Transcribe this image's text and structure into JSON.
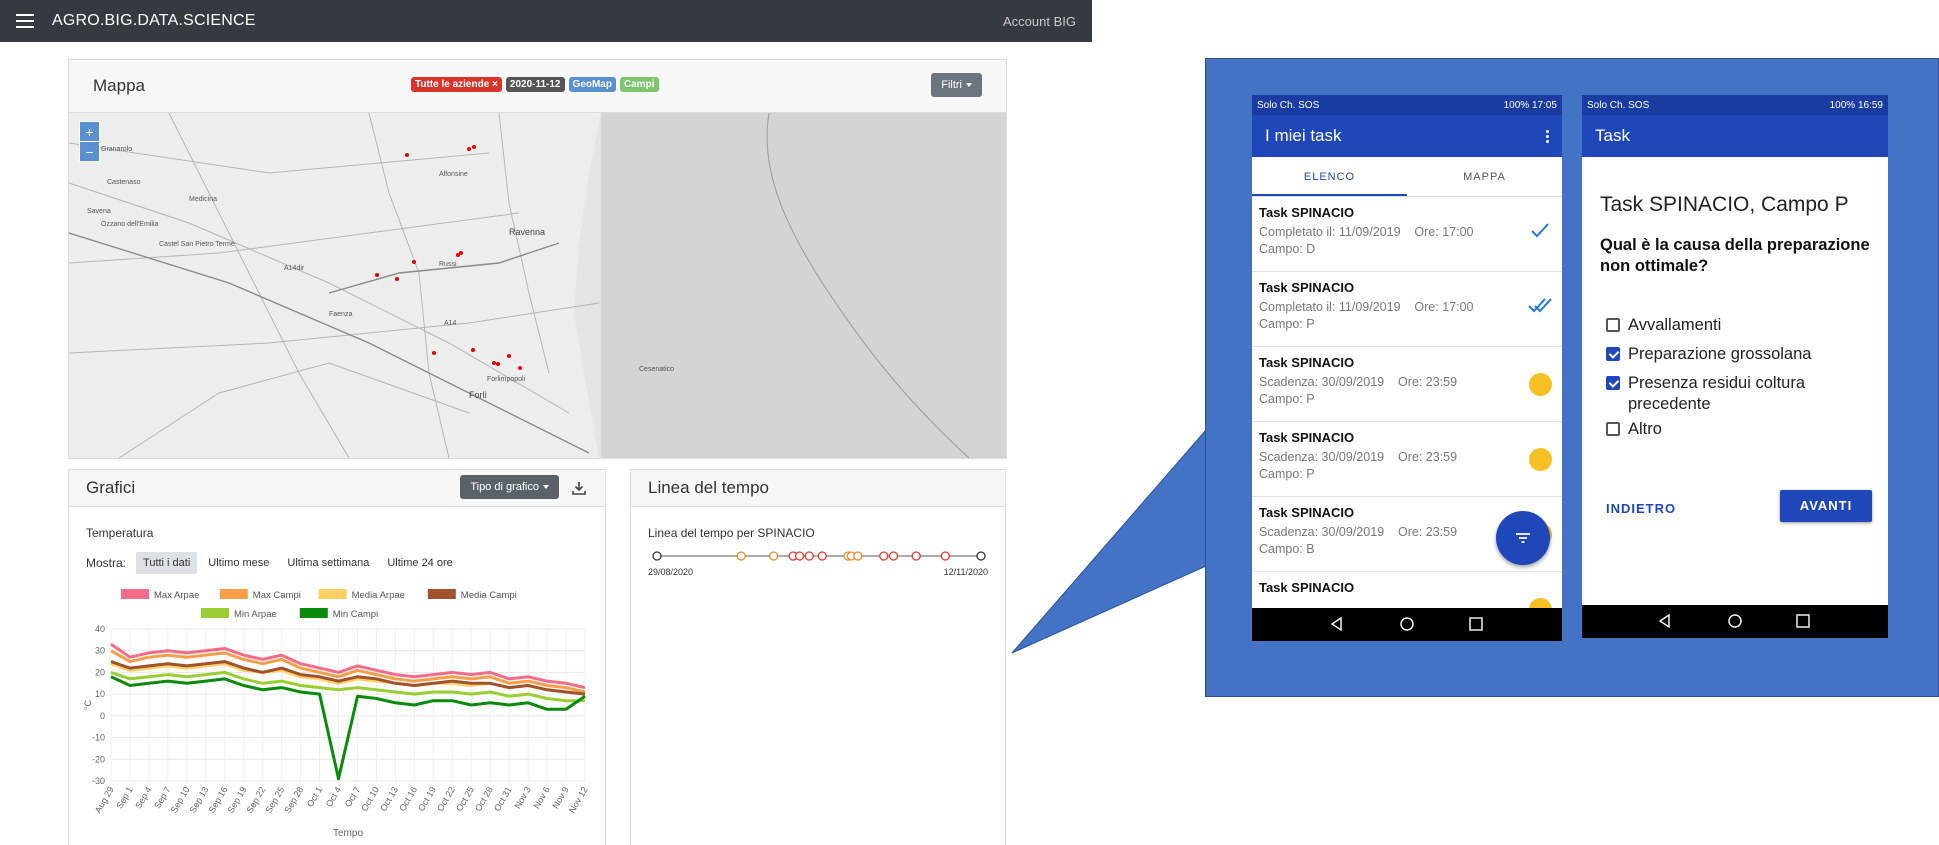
{
  "navbar": {
    "brand": "AGRO.BIG.DATA.SCIENCE",
    "account": "Account BIG"
  },
  "map_card": {
    "title": "Mappa",
    "badges": [
      {
        "label": "Tutte le aziende ×",
        "color": "#d9342b"
      },
      {
        "label": "2020-11-12",
        "color": "#555555"
      },
      {
        "label": "GeoMap",
        "color": "#5a8fd0"
      },
      {
        "label": "Campi",
        "color": "#7cc66b"
      }
    ],
    "filtri_label": "Filtri",
    "zoom_in": "+",
    "zoom_out": "−",
    "place_labels": [
      "Granarolo",
      "Castenaso",
      "Medicina",
      "Savena",
      "Ozzano dell'Emilia",
      "Castel San Pietro Terme",
      "Alfonsine",
      "Ravenna",
      "Russi",
      "A14dir",
      "Faenza",
      "A14",
      "Forlì",
      "Cesenatico",
      "Forlimpopoli"
    ],
    "dot_color": "#e00000"
  },
  "grafici_card": {
    "title": "Grafici",
    "tipo_label": "Tipo di grafico",
    "mostra_label": "Mostra:",
    "range_options": [
      "Tutti i dati",
      "Ultimo mese",
      "Ultima settimana",
      "Ultime 24 ore"
    ],
    "selected_range": "Tutti i dati"
  },
  "linea_card": {
    "title": "Linea del tempo",
    "subtitle": "Linea del tempo per SPINACIO",
    "start_date": "29/08/2020",
    "end_date": "12/11/2020"
  },
  "chart_data": {
    "type": "line",
    "title": "Temperatura",
    "xlabel": "Tempo",
    "ylabel": "°C",
    "ylim": [
      -30,
      40
    ],
    "yticks": [
      40,
      30,
      20,
      10,
      0,
      -10,
      -20,
      -30
    ],
    "categories": [
      "Aug 29",
      "Sep 1",
      "Sep 4",
      "Sep 7",
      "Sep 10",
      "Sep 13",
      "Sep 16",
      "Sep 19",
      "Sep 22",
      "Sep 25",
      "Sep 28",
      "Oct 1",
      "Oct 4",
      "Oct 7",
      "Oct 10",
      "Oct 13",
      "Oct 16",
      "Oct 19",
      "Oct 22",
      "Oct 25",
      "Oct 28",
      "Oct 31",
      "Nov 3",
      "Nov 6",
      "Nov 9",
      "Nov 12"
    ],
    "series": [
      {
        "name": "Max Arpae",
        "color": "#f66a8a",
        "values": [
          33,
          27,
          29,
          30,
          29,
          30,
          31,
          28,
          26,
          28,
          24,
          22,
          20,
          23,
          21,
          19,
          18,
          19,
          20,
          19,
          20,
          17,
          18,
          16,
          15,
          13
        ]
      },
      {
        "name": "Max Campi",
        "color": "#fb9e4a",
        "values": [
          30,
          25,
          27,
          28,
          27,
          28,
          29,
          26,
          24,
          26,
          22,
          20,
          18,
          21,
          19,
          17,
          16,
          17,
          18,
          17,
          18,
          15,
          16,
          14,
          13,
          11
        ]
      },
      {
        "name": "Media Arpae",
        "color": "#fcd064",
        "values": [
          24,
          21,
          22,
          23,
          22,
          23,
          24,
          21,
          20,
          21,
          18,
          17,
          15,
          17,
          16,
          15,
          14,
          15,
          15,
          14,
          15,
          13,
          14,
          12,
          11,
          10
        ]
      },
      {
        "name": "Media Campi",
        "color": "#a0522d",
        "values": [
          25,
          22,
          23,
          24,
          23,
          24,
          25,
          22,
          20,
          22,
          19,
          18,
          16,
          18,
          17,
          15,
          14,
          15,
          16,
          15,
          15,
          13,
          14,
          12,
          11,
          10
        ]
      },
      {
        "name": "Min Arpae",
        "color": "#9acd32",
        "values": [
          20,
          17,
          18,
          19,
          18,
          19,
          20,
          17,
          15,
          16,
          14,
          13,
          12,
          13,
          12,
          11,
          10,
          11,
          11,
          10,
          11,
          9,
          10,
          8,
          7,
          7
        ]
      },
      {
        "name": "Min Campi",
        "color": "#0a8a0a",
        "values": [
          18,
          14,
          15,
          16,
          15,
          16,
          17,
          14,
          12,
          13,
          11,
          10,
          -29,
          9,
          8,
          6,
          5,
          7,
          7,
          5,
          6,
          5,
          6,
          3,
          3,
          9
        ]
      }
    ],
    "legend_placement": "top",
    "grid": true
  },
  "timeline": {
    "events": [
      {
        "pos": 0.0,
        "color": "#333333"
      },
      {
        "pos": 0.26,
        "color": "#f08a24"
      },
      {
        "pos": 0.36,
        "color": "#f08a24"
      },
      {
        "pos": 0.42,
        "color": "#e03c31"
      },
      {
        "pos": 0.44,
        "color": "#e03c31"
      },
      {
        "pos": 0.47,
        "color": "#e03c31"
      },
      {
        "pos": 0.51,
        "color": "#e03c31"
      },
      {
        "pos": 0.59,
        "color": "#f08a24"
      },
      {
        "pos": 0.6,
        "color": "#f08a24"
      },
      {
        "pos": 0.62,
        "color": "#f08a24"
      },
      {
        "pos": 0.7,
        "color": "#e03c31"
      },
      {
        "pos": 0.73,
        "color": "#e03c31"
      },
      {
        "pos": 0.8,
        "color": "#e03c31"
      },
      {
        "pos": 0.89,
        "color": "#e03c31"
      },
      {
        "pos": 1.0,
        "color": "#333333"
      }
    ]
  },
  "phone1": {
    "status_left": "Solo Ch. SOS",
    "status_right": "100% 17:05",
    "title": "I miei task",
    "tabs": [
      "ELENCO",
      "MAPPA"
    ],
    "tasks": [
      {
        "name": "Task SPINACIO",
        "line1": "Completato il: 11/09/2019    Ore: 17:00",
        "line2": "Campo: D",
        "status": "check"
      },
      {
        "name": "Task SPINACIO",
        "line1": "Completato il: 11/09/2019    Ore: 17:00",
        "line2": "Campo: P",
        "status": "double-check"
      },
      {
        "name": "Task SPINACIO",
        "line1": "Scadenza: 30/09/2019    Ore: 23:59",
        "line2": "Campo: P",
        "status": "pending"
      },
      {
        "name": "Task SPINACIO",
        "line1": "Scadenza: 30/09/2019    Ore: 23:59",
        "line2": "Campo: P",
        "status": "pending"
      },
      {
        "name": "Task SPINACIO",
        "line1": "Scadenza: 30/09/2019    Ore: 23:59",
        "line2": "Campo: B",
        "status": "pending"
      },
      {
        "name": "Task SPINACIO",
        "line1": "",
        "line2": "",
        "status": "pending"
      }
    ]
  },
  "phone2": {
    "status_left": "Solo Ch. SOS",
    "status_right": "100% 16:59",
    "title": "Task",
    "heading": "Task SPINACIO, Campo P",
    "question": "Qual è la causa della preparazione non ottimale?",
    "options": [
      {
        "label": "Avvallamenti",
        "checked": false
      },
      {
        "label": "Preparazione grossolana",
        "checked": true
      },
      {
        "label": "Presenza residui coltura precedente",
        "checked": true
      },
      {
        "label": "Altro",
        "checked": false
      }
    ],
    "back_label": "INDIETRO",
    "next_label": "AVANTI"
  }
}
